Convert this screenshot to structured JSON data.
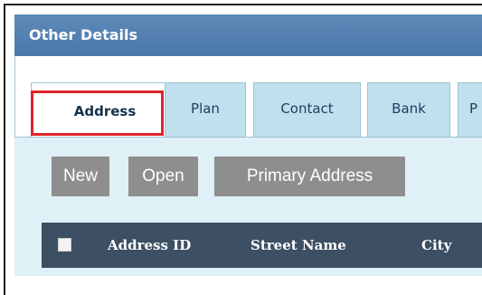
{
  "panel": {
    "title": "Other Details"
  },
  "tabs": [
    {
      "label": "Address"
    },
    {
      "label": "Plan"
    },
    {
      "label": "Contact"
    },
    {
      "label": "Bank"
    },
    {
      "label": "P"
    }
  ],
  "toolbar": {
    "new_label": "New",
    "open_label": "Open",
    "primary_address_label": "Primary Address"
  },
  "grid": {
    "columns": [
      "Address ID",
      "Street Name",
      "City"
    ]
  },
  "colors": {
    "header": "#4a78aa",
    "tab": "#bfe0ec",
    "content": "#dff0f6",
    "button": "#8e8e8e",
    "grid_header": "#3c4f63",
    "highlight": "#e0232a"
  }
}
